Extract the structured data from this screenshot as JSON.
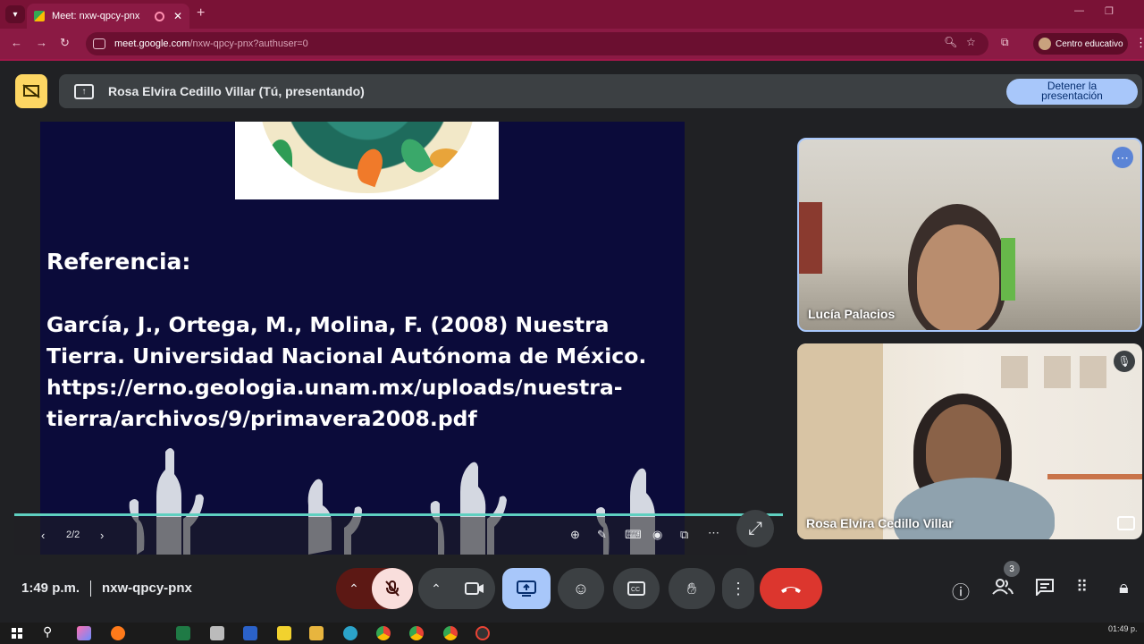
{
  "browser": {
    "tab_title": "Meet: nxw-qpcy-pnx",
    "url_host": "meet.google.com",
    "url_path": "/nxw-qpcy-pnx?authuser=0",
    "profile_label": "Centro educativo"
  },
  "presenting": {
    "banner_text": "Rosa Elvira Cedillo Villar (Tú, presentando)",
    "stop_button_line1": "Detener la",
    "stop_button_line2": "presentación"
  },
  "slide": {
    "title": "Referencia:",
    "body": "García, J., Ortega, M., Molina, F. (2008) Nuestra Tierra. Universidad Nacional Autónoma de México. https://erno.geologia.unam.mx/uploads/nuestra-tierra/archivos/9/primavera2008.pdf",
    "page_indicator": "2/2"
  },
  "participants": [
    {
      "name": "Lucía Palacios"
    },
    {
      "name": "Rosa Elvira Cedillo Villar"
    }
  ],
  "meeting": {
    "time": "1:49 p.m.",
    "code": "nxw-qpcy-pnx",
    "people_count": "3"
  },
  "taskbar": {
    "tray_time": "01:49 p."
  },
  "colors": {
    "chrome_frame": "#7a1236",
    "slide_background": "#0b0b3a",
    "stop_button": "#a8c7fa",
    "end_call": "#dc362e",
    "present_button": "#a8c7fa",
    "mic_muted": "#f9dedc",
    "accent_yellow": "#fdd663"
  }
}
